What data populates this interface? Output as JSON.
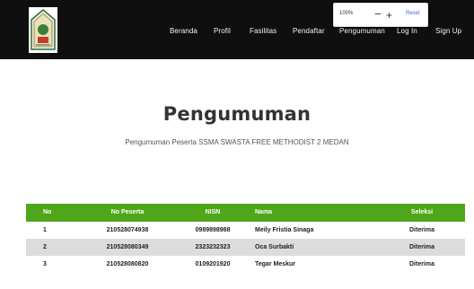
{
  "navbar": {
    "items": [
      {
        "label": "Beranda"
      },
      {
        "label": "Profil"
      },
      {
        "label": "Fasilitas"
      },
      {
        "label": "Pendaftar"
      },
      {
        "label": "Pengumuman"
      },
      {
        "label": "Log In"
      },
      {
        "label": "Sign Up"
      }
    ],
    "background": "#0f0f0f"
  },
  "zoom_popup": {
    "level": "100%",
    "minus": "−",
    "plus": "+",
    "reset": "Reset"
  },
  "main": {
    "title": "Pengumuman",
    "subtitle": "Pengumuman Peserta SSMA SWASTA FREE METHODIST 2 MEDAN"
  },
  "table": {
    "header_color": "#4fa61a",
    "columns": [
      "No",
      "No Peserta",
      "NISN",
      "Nama",
      "Seleksi"
    ],
    "rows": [
      [
        "1",
        "210528074938",
        "0989898988",
        "Meily Fristia Sinaga",
        "Diterima"
      ],
      [
        "2",
        "210528080349",
        "2323232323",
        "Oca Surbakti",
        "Diterima"
      ],
      [
        "3",
        "210528080820",
        "0109201920",
        "Tegar Meskur",
        "Diterima"
      ]
    ]
  }
}
